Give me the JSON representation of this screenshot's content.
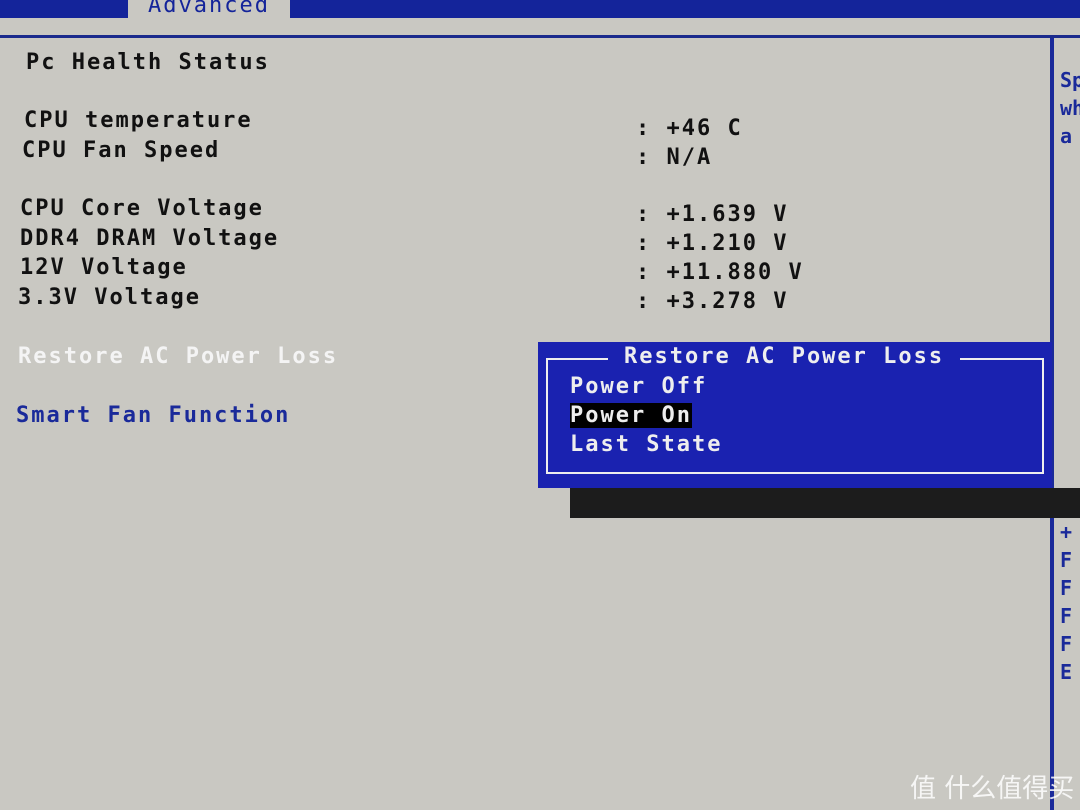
{
  "tab": "Advanced",
  "section_title": "Pc Health Status",
  "readings": [
    {
      "label": "CPU temperature",
      "value": ": +46 C"
    },
    {
      "label": "CPU Fan Speed",
      "value": ": N/A"
    },
    {
      "label": "CPU Core Voltage",
      "value": ": +1.639 V"
    },
    {
      "label": "DDR4 DRAM Voltage",
      "value": ": +1.210 V"
    },
    {
      "label": "12V Voltage",
      "value": ": +11.880 V"
    },
    {
      "label": "3.3V Voltage",
      "value": ": +3.278 V"
    }
  ],
  "settings": {
    "restore_ac": "Restore AC Power Loss",
    "smart_fan": "Smart Fan Function"
  },
  "popup": {
    "title": "Restore AC Power Loss",
    "options": [
      "Power Off",
      "Power On",
      "Last State"
    ],
    "selected": "Power On"
  },
  "help": {
    "top": [
      "Sp",
      "wh",
      "a"
    ],
    "keys": [
      "+",
      "F",
      "F",
      "F",
      "F",
      "E"
    ]
  },
  "watermark": "值 什么值得买"
}
